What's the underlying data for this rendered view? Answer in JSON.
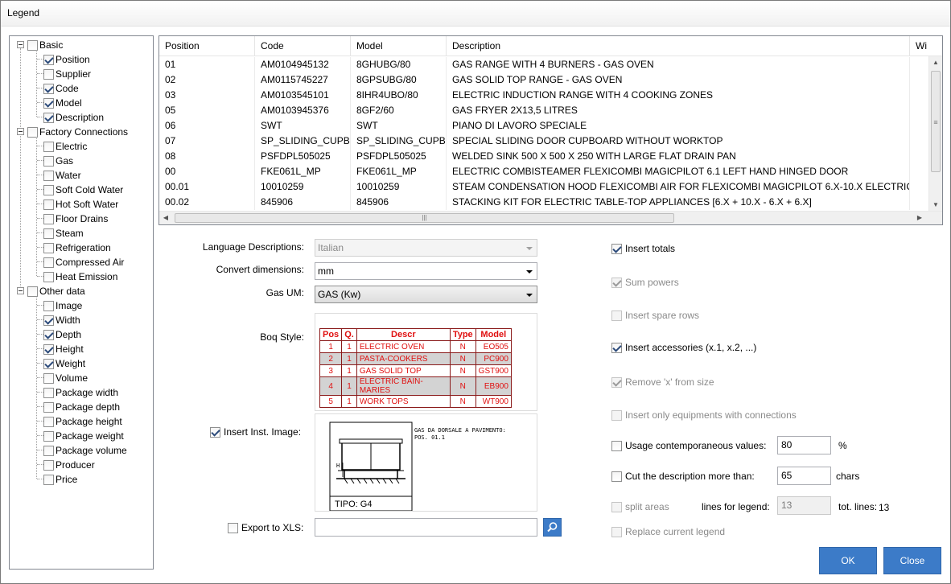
{
  "window": {
    "title": "Legend"
  },
  "tree": {
    "groups": [
      {
        "label": "Basic",
        "checked": false,
        "items": [
          {
            "label": "Position",
            "checked": true
          },
          {
            "label": "Supplier",
            "checked": false
          },
          {
            "label": "Code",
            "checked": true
          },
          {
            "label": "Model",
            "checked": true
          },
          {
            "label": "Description",
            "checked": true
          }
        ]
      },
      {
        "label": "Factory Connections",
        "checked": false,
        "items": [
          {
            "label": "Electric",
            "checked": false
          },
          {
            "label": "Gas",
            "checked": false
          },
          {
            "label": "Water",
            "checked": false
          },
          {
            "label": "Soft Cold Water",
            "checked": false
          },
          {
            "label": "Hot Soft Water",
            "checked": false
          },
          {
            "label": "Floor Drains",
            "checked": false
          },
          {
            "label": "Steam",
            "checked": false
          },
          {
            "label": "Refrigeration",
            "checked": false
          },
          {
            "label": "Compressed Air",
            "checked": false
          },
          {
            "label": "Heat Emission",
            "checked": false
          }
        ]
      },
      {
        "label": "Other data",
        "checked": false,
        "items": [
          {
            "label": "Image",
            "checked": false
          },
          {
            "label": "Width",
            "checked": true
          },
          {
            "label": "Depth",
            "checked": true
          },
          {
            "label": "Height",
            "checked": true
          },
          {
            "label": "Weight",
            "checked": true
          },
          {
            "label": "Volume",
            "checked": false
          },
          {
            "label": "Package width",
            "checked": false
          },
          {
            "label": "Package depth",
            "checked": false
          },
          {
            "label": "Package height",
            "checked": false
          },
          {
            "label": "Package weight",
            "checked": false
          },
          {
            "label": "Package volume",
            "checked": false
          },
          {
            "label": "Producer",
            "checked": false
          },
          {
            "label": "Price",
            "checked": false
          }
        ]
      }
    ]
  },
  "grid": {
    "columns": [
      "Position",
      "Code",
      "Model",
      "Description",
      "Wi"
    ],
    "rows": [
      [
        "01",
        "AM0104945132",
        "8GHUBG/80",
        "GAS RANGE WITH 4 BURNERS - GAS OVEN"
      ],
      [
        "02",
        "AM0115745227",
        "8GPSUBG/80",
        "GAS SOLID TOP RANGE - GAS OVEN"
      ],
      [
        "03",
        "AM0103545101",
        "8IHR4UBO/80",
        "ELECTRIC INDUCTION RANGE WITH 4 COOKING ZONES"
      ],
      [
        "05",
        "AM0103945376",
        "8GF2/60",
        "GAS FRYER 2X13,5 LITRES"
      ],
      [
        "06",
        "SWT",
        "SWT",
        "PIANO DI LAVORO SPECIALE"
      ],
      [
        "07",
        "SP_SLIDING_CUPB",
        "SP_SLIDING_CUPB",
        "SPECIAL SLIDING DOOR CUPBOARD WITHOUT WORKTOP"
      ],
      [
        "08",
        "PSFDPL505025",
        "PSFDPL505025",
        "WELDED SINK 500 X 500 X 250 WITH LARGE FLAT DRAIN PAN"
      ],
      [
        "00",
        "FKE061L_MP",
        "FKE061L_MP",
        "ELECTRIC COMBISTEAMER FLEXICOMBI MAGICPILOT 6.1 LEFT HAND HINGED DOOR"
      ],
      [
        "00.01",
        "10010259",
        "10010259",
        "STEAM CONDENSATION HOOD FLEXICOMBI AIR FOR FLEXICOMBI MAGICPILOT 6.X-10.X ELECTRIC"
      ],
      [
        "00.02",
        "845906",
        "845906",
        "STACKING KIT FOR ELECTRIC TABLE-TOP APPLIANCES [6.X + 10.X - 6.X + 6.X]"
      ]
    ],
    "hscroll_grip": "|||",
    "vscroll_grip": "≡"
  },
  "form": {
    "language_label": "Language Descriptions:",
    "language_value": "Italian",
    "convert_label": "Convert dimensions:",
    "convert_value": "mm",
    "gas_label": "Gas UM:",
    "gas_value": "GAS (Kw)",
    "boq_label": "Boq Style:",
    "inst_image_label": "Insert Inst. Image:",
    "inst_image_checked": true,
    "export_label": "Export to XLS:",
    "export_checked": false,
    "export_value": ""
  },
  "boq": {
    "headers": [
      "Pos",
      "Q.",
      "Descr",
      "Type",
      "Model"
    ],
    "rows": [
      [
        "1",
        "1",
        "ELECTRIC OVEN",
        "N",
        "EO505"
      ],
      [
        "2",
        "1",
        "PASTA-COOKERS",
        "N",
        "PC900"
      ],
      [
        "3",
        "1",
        "GAS SOLID TOP",
        "N",
        "GST900"
      ],
      [
        "4",
        "1",
        "ELECTRIC BAIN-MARIES",
        "N",
        "EB900"
      ],
      [
        "5",
        "1",
        "WORK TOPS",
        "N",
        "WT900"
      ]
    ]
  },
  "inst_image": {
    "note_line1": "GAS DA DORSALE A PAVIMENTO:",
    "note_line2": "POS. 01.1",
    "tipo": "TIPO: G4",
    "h_mark": "H"
  },
  "options": {
    "insert_totals": {
      "label": "Insert totals",
      "checked": true,
      "enabled": true
    },
    "sum_powers": {
      "label": "Sum powers",
      "checked": true,
      "enabled": false
    },
    "insert_spare_rows": {
      "label": "Insert spare rows",
      "checked": false,
      "enabled": false
    },
    "insert_accessories": {
      "label": "Insert accessories (x.1, x.2, ...)",
      "checked": true,
      "enabled": true
    },
    "remove_x": {
      "label": "Remove 'x' from size",
      "checked": true,
      "enabled": false
    },
    "only_connections": {
      "label": "Insert only equipments with connections",
      "checked": false,
      "enabled": false
    },
    "usage": {
      "label": "Usage contemporaneous values:",
      "checked": false,
      "value": "80",
      "unit": "%"
    },
    "cut_description": {
      "label": "Cut the description more than:",
      "checked": false,
      "value": "65",
      "unit": "chars"
    },
    "split_areas": {
      "label": "split areas",
      "checked": false,
      "lines_label": "lines for legend:",
      "lines_value": "13",
      "tot_label": "tot. lines:",
      "tot_value": "13"
    },
    "replace_legend": {
      "label": "Replace current legend",
      "checked": false
    }
  },
  "buttons": {
    "ok": "OK",
    "close": "Close"
  },
  "colors": {
    "accent": "#3c7bc8",
    "boq_red": "#e01010"
  }
}
